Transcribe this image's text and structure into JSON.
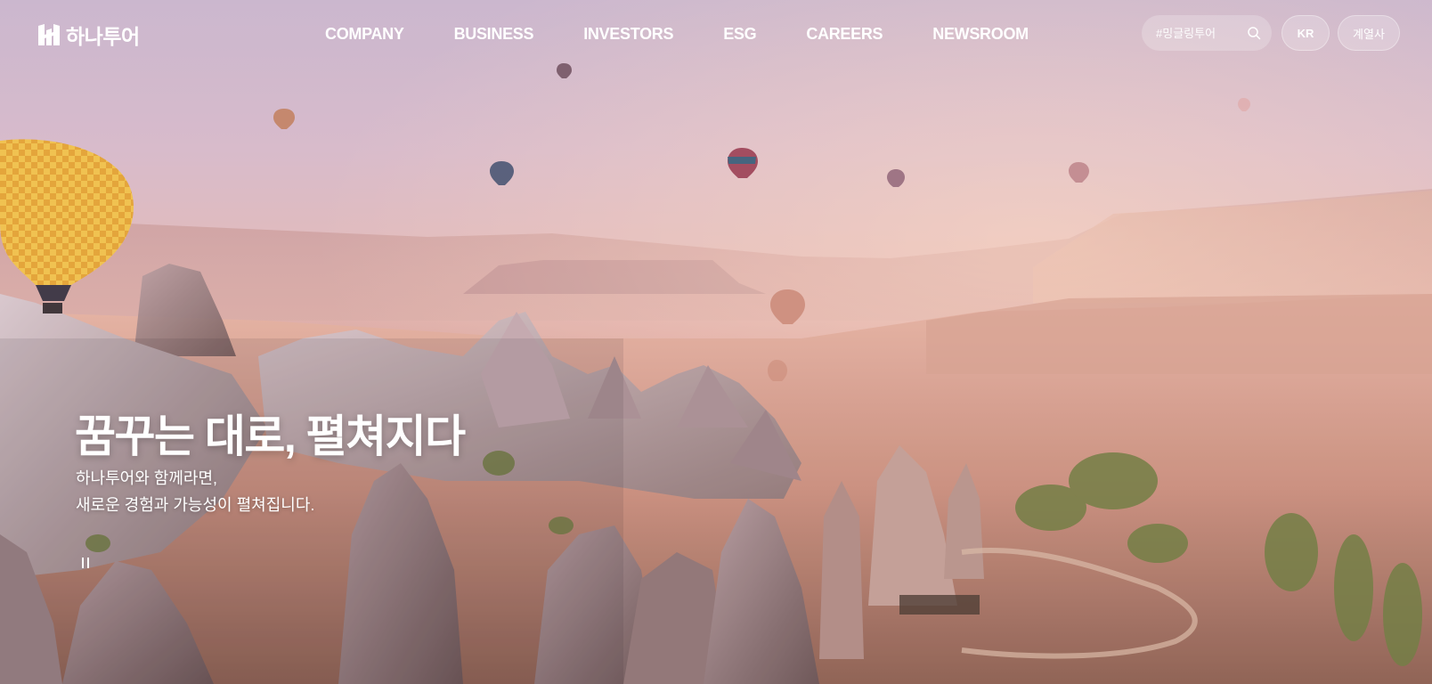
{
  "header": {
    "logo_text": "하나투어",
    "nav": [
      {
        "label": "COMPANY"
      },
      {
        "label": "BUSINESS"
      },
      {
        "label": "INVESTORS"
      },
      {
        "label": "ESG"
      },
      {
        "label": "CAREERS"
      },
      {
        "label": "NEWSROOM"
      }
    ],
    "search": {
      "placeholder": "#밍글링투어",
      "icon": "search-icon"
    },
    "language_label": "KR",
    "affiliates_label": "계열사"
  },
  "hero": {
    "title": "꿈꾸는 대로, 펼쳐지다",
    "subtitle_line1": "하나투어와 함께라면,",
    "subtitle_line2": "새로운 경험과 가능성이 펼쳐집니다.",
    "pause_icon": "pause-icon"
  },
  "colors": {
    "sky_top": "#c9b5cc",
    "haze": "#e2b9b7",
    "ground": "#5c4640",
    "text": "#ffffff"
  }
}
